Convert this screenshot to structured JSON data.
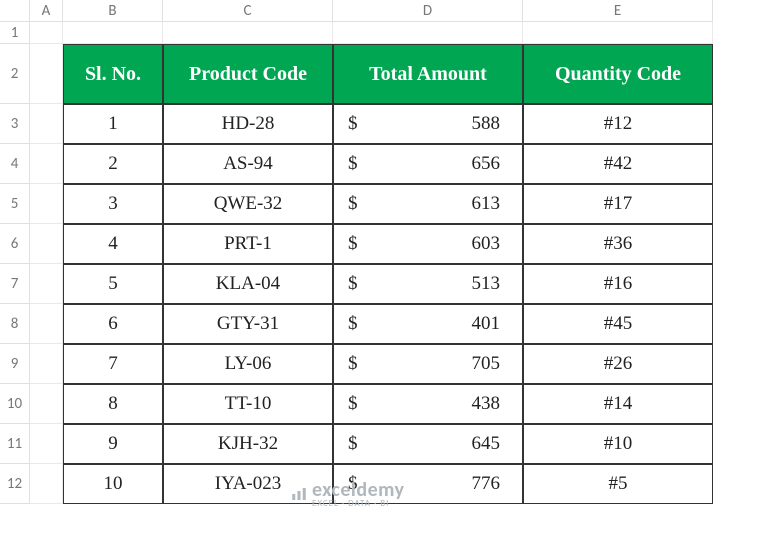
{
  "columns": [
    "A",
    "B",
    "C",
    "D",
    "E"
  ],
  "rowNumbers": [
    "1",
    "2",
    "3",
    "4",
    "5",
    "6",
    "7",
    "8",
    "9",
    "10",
    "11",
    "12"
  ],
  "headers": {
    "sl": "Sl. No.",
    "product": "Product Code",
    "amount": "Total Amount",
    "qty": "Quantity Code"
  },
  "currency": "$",
  "rows": [
    {
      "sl": "1",
      "product": "HD-28",
      "amount": "588",
      "qty": "#12"
    },
    {
      "sl": "2",
      "product": "AS-94",
      "amount": "656",
      "qty": "#42"
    },
    {
      "sl": "3",
      "product": "QWE-32",
      "amount": "613",
      "qty": "#17"
    },
    {
      "sl": "4",
      "product": "PRT-1",
      "amount": "603",
      "qty": "#36"
    },
    {
      "sl": "5",
      "product": "KLA-04",
      "amount": "513",
      "qty": "#16"
    },
    {
      "sl": "6",
      "product": "GTY-31",
      "amount": "401",
      "qty": "#45"
    },
    {
      "sl": "7",
      "product": "LY-06",
      "amount": "705",
      "qty": "#26"
    },
    {
      "sl": "8",
      "product": "TT-10",
      "amount": "438",
      "qty": "#14"
    },
    {
      "sl": "9",
      "product": "KJH-32",
      "amount": "645",
      "qty": "#10"
    },
    {
      "sl": "10",
      "product": "IYA-023",
      "amount": "776",
      "qty": "#5"
    }
  ],
  "watermark": {
    "brand": "exceldemy",
    "tag": "EXCEL · DATA · BI"
  },
  "chart_data": {
    "type": "table",
    "title": "",
    "columns": [
      "Sl. No.",
      "Product Code",
      "Total Amount",
      "Quantity Code"
    ],
    "rows": [
      [
        1,
        "HD-28",
        588,
        "#12"
      ],
      [
        2,
        "AS-94",
        656,
        "#42"
      ],
      [
        3,
        "QWE-32",
        613,
        "#17"
      ],
      [
        4,
        "PRT-1",
        603,
        "#36"
      ],
      [
        5,
        "KLA-04",
        513,
        "#16"
      ],
      [
        6,
        "GTY-31",
        401,
        "#45"
      ],
      [
        7,
        "LY-06",
        705,
        "#26"
      ],
      [
        8,
        "TT-10",
        438,
        "#14"
      ],
      [
        9,
        "KJH-32",
        645,
        "#10"
      ],
      [
        10,
        "IYA-023",
        776,
        "#5"
      ]
    ]
  }
}
